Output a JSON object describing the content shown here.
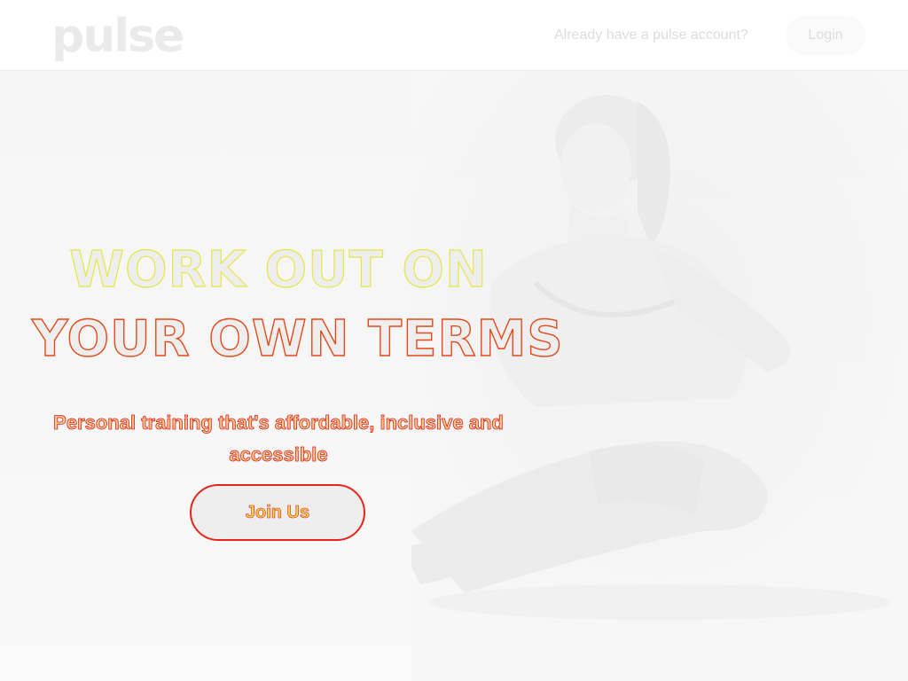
{
  "header": {
    "logo_text": "pulse",
    "account_prompt": "Already have a pulse account?",
    "login_label": "Login"
  },
  "hero": {
    "headline_line1": "WORK OUT ON",
    "headline_line2": "YOUR OWN TERMS",
    "subheading": "Personal training that's affordable, inclusive and accessible",
    "cta_label": "Join Us"
  },
  "colors": {
    "logo": "#eaeaea",
    "headline_outline_top": "#e6e64a",
    "headline_outline_bottom": "#e44a1a",
    "cta_border": "#e8241a"
  },
  "icons": {
    "hero_image": "woman-stretching-photo"
  }
}
